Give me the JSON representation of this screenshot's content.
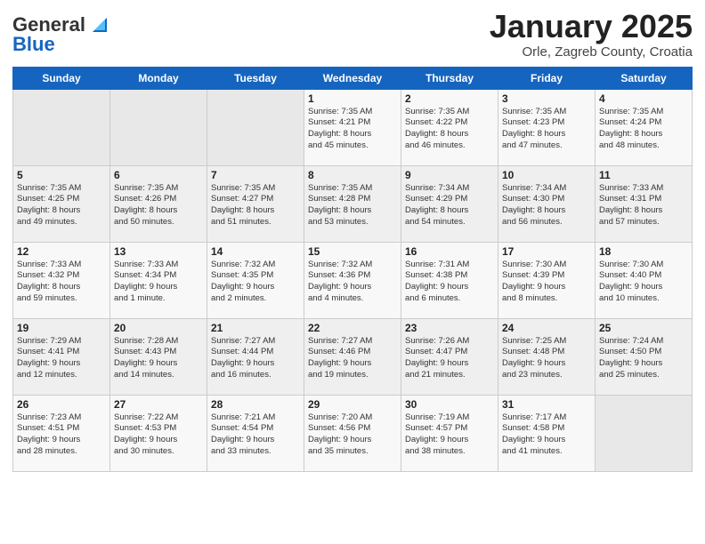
{
  "header": {
    "logo_general": "General",
    "logo_blue": "Blue",
    "month_title": "January 2025",
    "location": "Orle, Zagreb County, Croatia"
  },
  "days_of_week": [
    "Sunday",
    "Monday",
    "Tuesday",
    "Wednesday",
    "Thursday",
    "Friday",
    "Saturday"
  ],
  "weeks": [
    [
      {
        "day": "",
        "text": ""
      },
      {
        "day": "",
        "text": ""
      },
      {
        "day": "",
        "text": ""
      },
      {
        "day": "1",
        "text": "Sunrise: 7:35 AM\nSunset: 4:21 PM\nDaylight: 8 hours\nand 45 minutes."
      },
      {
        "day": "2",
        "text": "Sunrise: 7:35 AM\nSunset: 4:22 PM\nDaylight: 8 hours\nand 46 minutes."
      },
      {
        "day": "3",
        "text": "Sunrise: 7:35 AM\nSunset: 4:23 PM\nDaylight: 8 hours\nand 47 minutes."
      },
      {
        "day": "4",
        "text": "Sunrise: 7:35 AM\nSunset: 4:24 PM\nDaylight: 8 hours\nand 48 minutes."
      }
    ],
    [
      {
        "day": "5",
        "text": "Sunrise: 7:35 AM\nSunset: 4:25 PM\nDaylight: 8 hours\nand 49 minutes."
      },
      {
        "day": "6",
        "text": "Sunrise: 7:35 AM\nSunset: 4:26 PM\nDaylight: 8 hours\nand 50 minutes."
      },
      {
        "day": "7",
        "text": "Sunrise: 7:35 AM\nSunset: 4:27 PM\nDaylight: 8 hours\nand 51 minutes."
      },
      {
        "day": "8",
        "text": "Sunrise: 7:35 AM\nSunset: 4:28 PM\nDaylight: 8 hours\nand 53 minutes."
      },
      {
        "day": "9",
        "text": "Sunrise: 7:34 AM\nSunset: 4:29 PM\nDaylight: 8 hours\nand 54 minutes."
      },
      {
        "day": "10",
        "text": "Sunrise: 7:34 AM\nSunset: 4:30 PM\nDaylight: 8 hours\nand 56 minutes."
      },
      {
        "day": "11",
        "text": "Sunrise: 7:33 AM\nSunset: 4:31 PM\nDaylight: 8 hours\nand 57 minutes."
      }
    ],
    [
      {
        "day": "12",
        "text": "Sunrise: 7:33 AM\nSunset: 4:32 PM\nDaylight: 8 hours\nand 59 minutes."
      },
      {
        "day": "13",
        "text": "Sunrise: 7:33 AM\nSunset: 4:34 PM\nDaylight: 9 hours\nand 1 minute."
      },
      {
        "day": "14",
        "text": "Sunrise: 7:32 AM\nSunset: 4:35 PM\nDaylight: 9 hours\nand 2 minutes."
      },
      {
        "day": "15",
        "text": "Sunrise: 7:32 AM\nSunset: 4:36 PM\nDaylight: 9 hours\nand 4 minutes."
      },
      {
        "day": "16",
        "text": "Sunrise: 7:31 AM\nSunset: 4:38 PM\nDaylight: 9 hours\nand 6 minutes."
      },
      {
        "day": "17",
        "text": "Sunrise: 7:30 AM\nSunset: 4:39 PM\nDaylight: 9 hours\nand 8 minutes."
      },
      {
        "day": "18",
        "text": "Sunrise: 7:30 AM\nSunset: 4:40 PM\nDaylight: 9 hours\nand 10 minutes."
      }
    ],
    [
      {
        "day": "19",
        "text": "Sunrise: 7:29 AM\nSunset: 4:41 PM\nDaylight: 9 hours\nand 12 minutes."
      },
      {
        "day": "20",
        "text": "Sunrise: 7:28 AM\nSunset: 4:43 PM\nDaylight: 9 hours\nand 14 minutes."
      },
      {
        "day": "21",
        "text": "Sunrise: 7:27 AM\nSunset: 4:44 PM\nDaylight: 9 hours\nand 16 minutes."
      },
      {
        "day": "22",
        "text": "Sunrise: 7:27 AM\nSunset: 4:46 PM\nDaylight: 9 hours\nand 19 minutes."
      },
      {
        "day": "23",
        "text": "Sunrise: 7:26 AM\nSunset: 4:47 PM\nDaylight: 9 hours\nand 21 minutes."
      },
      {
        "day": "24",
        "text": "Sunrise: 7:25 AM\nSunset: 4:48 PM\nDaylight: 9 hours\nand 23 minutes."
      },
      {
        "day": "25",
        "text": "Sunrise: 7:24 AM\nSunset: 4:50 PM\nDaylight: 9 hours\nand 25 minutes."
      }
    ],
    [
      {
        "day": "26",
        "text": "Sunrise: 7:23 AM\nSunset: 4:51 PM\nDaylight: 9 hours\nand 28 minutes."
      },
      {
        "day": "27",
        "text": "Sunrise: 7:22 AM\nSunset: 4:53 PM\nDaylight: 9 hours\nand 30 minutes."
      },
      {
        "day": "28",
        "text": "Sunrise: 7:21 AM\nSunset: 4:54 PM\nDaylight: 9 hours\nand 33 minutes."
      },
      {
        "day": "29",
        "text": "Sunrise: 7:20 AM\nSunset: 4:56 PM\nDaylight: 9 hours\nand 35 minutes."
      },
      {
        "day": "30",
        "text": "Sunrise: 7:19 AM\nSunset: 4:57 PM\nDaylight: 9 hours\nand 38 minutes."
      },
      {
        "day": "31",
        "text": "Sunrise: 7:17 AM\nSunset: 4:58 PM\nDaylight: 9 hours\nand 41 minutes."
      },
      {
        "day": "",
        "text": ""
      }
    ]
  ]
}
